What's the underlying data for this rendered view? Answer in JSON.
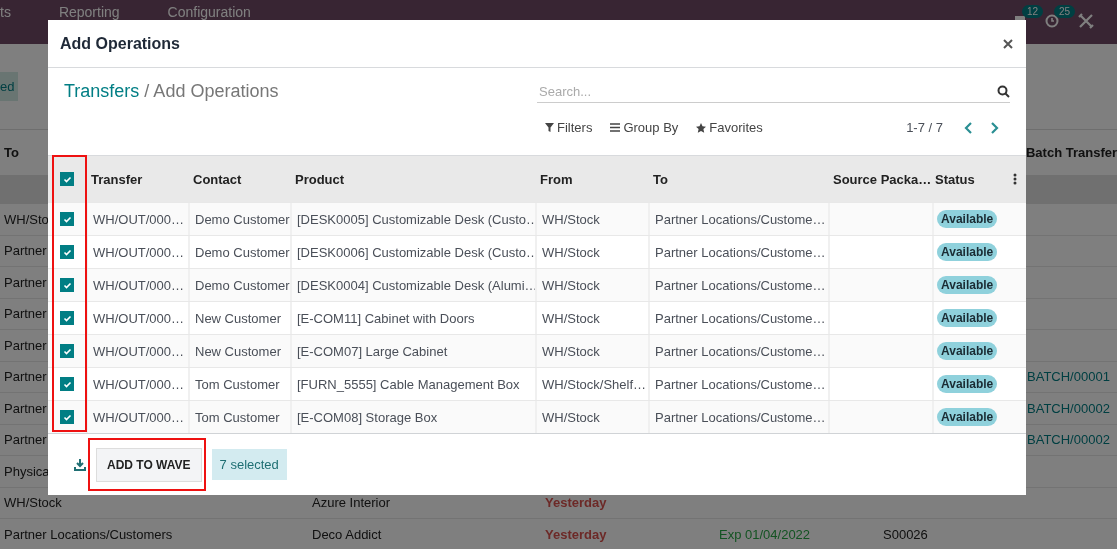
{
  "background": {
    "nav": [
      {
        "label": "ts"
      },
      {
        "label": "Reporting"
      },
      {
        "label": "Configuration"
      }
    ],
    "badges": [
      "12",
      "25"
    ],
    "filter_button": "ed",
    "columns": [
      "To",
      "Batch Transfer"
    ],
    "rows": [
      {
        "location": "WH/Sto"
      },
      {
        "location": "Partner"
      },
      {
        "location": "Partner"
      },
      {
        "location": "Partner"
      },
      {
        "location": "Partner"
      },
      {
        "location": "Partner",
        "batch": "BATCH/00001"
      },
      {
        "location": "Partner",
        "batch": "BATCH/00002"
      },
      {
        "location": "Partner",
        "batch": "BATCH/00002"
      },
      {
        "location": "Physica"
      },
      {
        "location": "WH/Stock",
        "contact": "Azure Interior",
        "date": "Yesterday"
      },
      {
        "location": "Partner Locations/Customers",
        "contact": "Deco Addict",
        "date": "Yesterday",
        "expected": "Exp 01/04/2022",
        "source": "S00026"
      }
    ]
  },
  "dialog": {
    "title": "Add Operations",
    "breadcrumb": {
      "parent": "Transfers",
      "separator": "/",
      "current": "Add Operations"
    },
    "search": {
      "placeholder": "Search..."
    },
    "filters": [
      {
        "kind": "filter",
        "label": "Filters"
      },
      {
        "kind": "group",
        "label": "Group By"
      },
      {
        "kind": "favorite",
        "label": "Favorites"
      }
    ],
    "pager": "1-7 / 7",
    "select_all": {
      "checked": true
    },
    "columns": [
      "Transfer",
      "Contact",
      "Product",
      "From",
      "To",
      "Source Packa…",
      "Status"
    ],
    "rows": [
      {
        "checked": true,
        "transfer": "WH/OUT/000…",
        "contact": "Demo Customer",
        "product": "[DESK0005] Customizable Desk (Custo…",
        "from": "WH/Stock",
        "to": "Partner Locations/Custome…",
        "status": "Available"
      },
      {
        "checked": true,
        "transfer": "WH/OUT/000…",
        "contact": "Demo Customer",
        "product": "[DESK0006] Customizable Desk (Custo…",
        "from": "WH/Stock",
        "to": "Partner Locations/Custome…",
        "status": "Available"
      },
      {
        "checked": true,
        "transfer": "WH/OUT/000…",
        "contact": "Demo Customer",
        "product": "[DESK0004] Customizable Desk (Alumi…",
        "from": "WH/Stock",
        "to": "Partner Locations/Custome…",
        "status": "Available"
      },
      {
        "checked": true,
        "transfer": "WH/OUT/000…",
        "contact": "New Customer",
        "product": "[E-COM11] Cabinet with Doors",
        "from": "WH/Stock",
        "to": "Partner Locations/Custome…",
        "status": "Available"
      },
      {
        "checked": true,
        "transfer": "WH/OUT/000…",
        "contact": "New Customer",
        "product": "[E-COM07] Large Cabinet",
        "from": "WH/Stock",
        "to": "Partner Locations/Custome…",
        "status": "Available"
      },
      {
        "checked": true,
        "transfer": "WH/OUT/000…",
        "contact": "Tom Customer",
        "product": "[FURN_5555] Cable Management Box",
        "from": "WH/Stock/Shelf…",
        "to": "Partner Locations/Custome…",
        "status": "Available"
      },
      {
        "checked": true,
        "transfer": "WH/OUT/000…",
        "contact": "Tom Customer",
        "product": "[E-COM08] Storage Box",
        "from": "WH/Stock",
        "to": "Partner Locations/Custome…",
        "status": "Available"
      }
    ],
    "footer": {
      "button": "ADD TO WAVE",
      "selection": "7 selected"
    }
  }
}
